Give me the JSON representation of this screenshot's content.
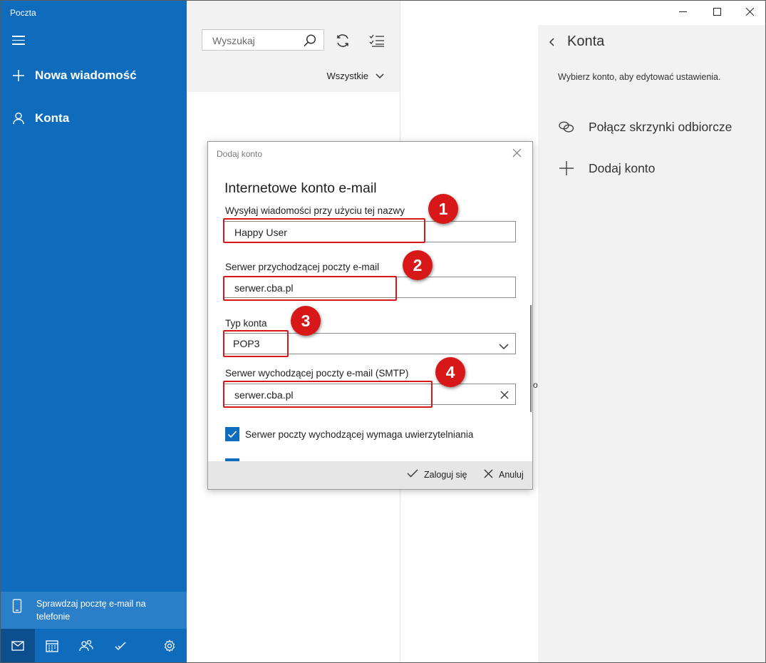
{
  "app": {
    "title": "Poczta"
  },
  "sidebar": {
    "new_message": "Nowa wiadomość",
    "accounts": "Konta",
    "promo": "Sprawdzaj pocztę e-mail na telefonie",
    "bottom_icons": [
      "mail-icon",
      "calendar-icon",
      "people-icon",
      "todo-icon",
      "settings-icon"
    ]
  },
  "list": {
    "search_placeholder": "Wyszukaj",
    "filter": "Wszystkie"
  },
  "accounts_panel": {
    "title": "Konta",
    "description": "Wybierz konto, aby edytować ustawienia.",
    "items": [
      {
        "label": "Połącz skrzynki odbiorcze",
        "icon": "link-icon"
      },
      {
        "label": "Dodaj konto",
        "icon": "plus-icon"
      }
    ]
  },
  "dialog": {
    "title": "Dodaj konto",
    "heading": "Internetowe konto e-mail",
    "fields": {
      "send_name": {
        "label": "Wysyłaj wiadomości przy użyciu tej nazwy",
        "value": "Happy User"
      },
      "incoming": {
        "label": "Serwer przychodzącej poczty e-mail",
        "value": "serwer.cba.pl"
      },
      "account_type": {
        "label": "Typ konta",
        "value": "POP3"
      },
      "outgoing": {
        "label": "Serwer wychodzącej poczty e-mail (SMTP)",
        "value": "serwer.cba.pl"
      }
    },
    "checkbox_label": "Serwer poczty wychodzącej wymaga uwierzytelniania",
    "signin": "Zaloguj się",
    "cancel": "Anuluj"
  },
  "annotations": [
    "1",
    "2",
    "3",
    "4"
  ],
  "stray_text": "o",
  "colors": {
    "accent": "#0f6cbd",
    "annotation": "#d81818",
    "panel_bg": "#f2f2f2"
  }
}
